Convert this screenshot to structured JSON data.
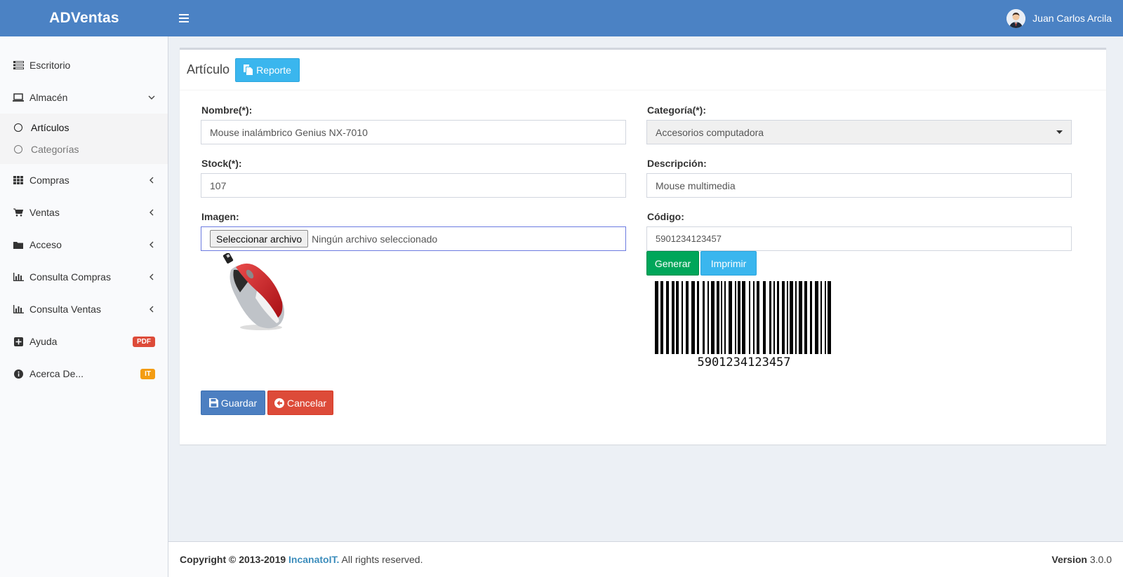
{
  "app": {
    "brand": "ADVentas"
  },
  "user": {
    "name": "Juan Carlos Arcila"
  },
  "sidebar": {
    "items": [
      {
        "label": "Escritorio"
      },
      {
        "label": "Almacén"
      },
      {
        "label": "Compras"
      },
      {
        "label": "Ventas"
      },
      {
        "label": "Acceso"
      },
      {
        "label": "Consulta Compras"
      },
      {
        "label": "Consulta Ventas"
      },
      {
        "label": "Ayuda",
        "badge": "PDF"
      },
      {
        "label": "Acerca De...",
        "badge": "IT"
      }
    ],
    "almacen_sub": [
      {
        "label": "Artículos"
      },
      {
        "label": "Categorías"
      }
    ]
  },
  "page": {
    "title": "Artículo",
    "report_button": "Reporte"
  },
  "form": {
    "nombre_label": "Nombre(*):",
    "nombre_value": "Mouse inalámbrico Genius NX-7010",
    "categoria_label": "Categoría(*):",
    "categoria_value": "Accesorios computadora",
    "stock_label": "Stock(*):",
    "stock_value": "107",
    "descripcion_label": "Descripción:",
    "descripcion_value": "Mouse multimedia",
    "imagen_label": "Imagen:",
    "file_button": "Seleccionar archivo",
    "file_status": "Ningún archivo seleccionado",
    "codigo_label": "Código:",
    "codigo_value": "5901234123457",
    "generar_button": "Generar",
    "imprimir_button": "Imprimir",
    "barcode_text": "5901234123457",
    "guardar_button": "Guardar",
    "cancelar_button": "Cancelar"
  },
  "footer": {
    "copyright_prefix": "Copyright © 2013-2019",
    "company": "IncanatoIT.",
    "rights": "All rights reserved.",
    "version_label": "Version",
    "version_value": "3.0.0"
  },
  "colors": {
    "header": "#4b82c4",
    "info": "#3ab6ee",
    "success": "#00a65a",
    "primary": "#4c7fc1",
    "danger": "#dd4b39",
    "badge_pdf": "#dd4b39",
    "badge_it": "#f39c12"
  }
}
